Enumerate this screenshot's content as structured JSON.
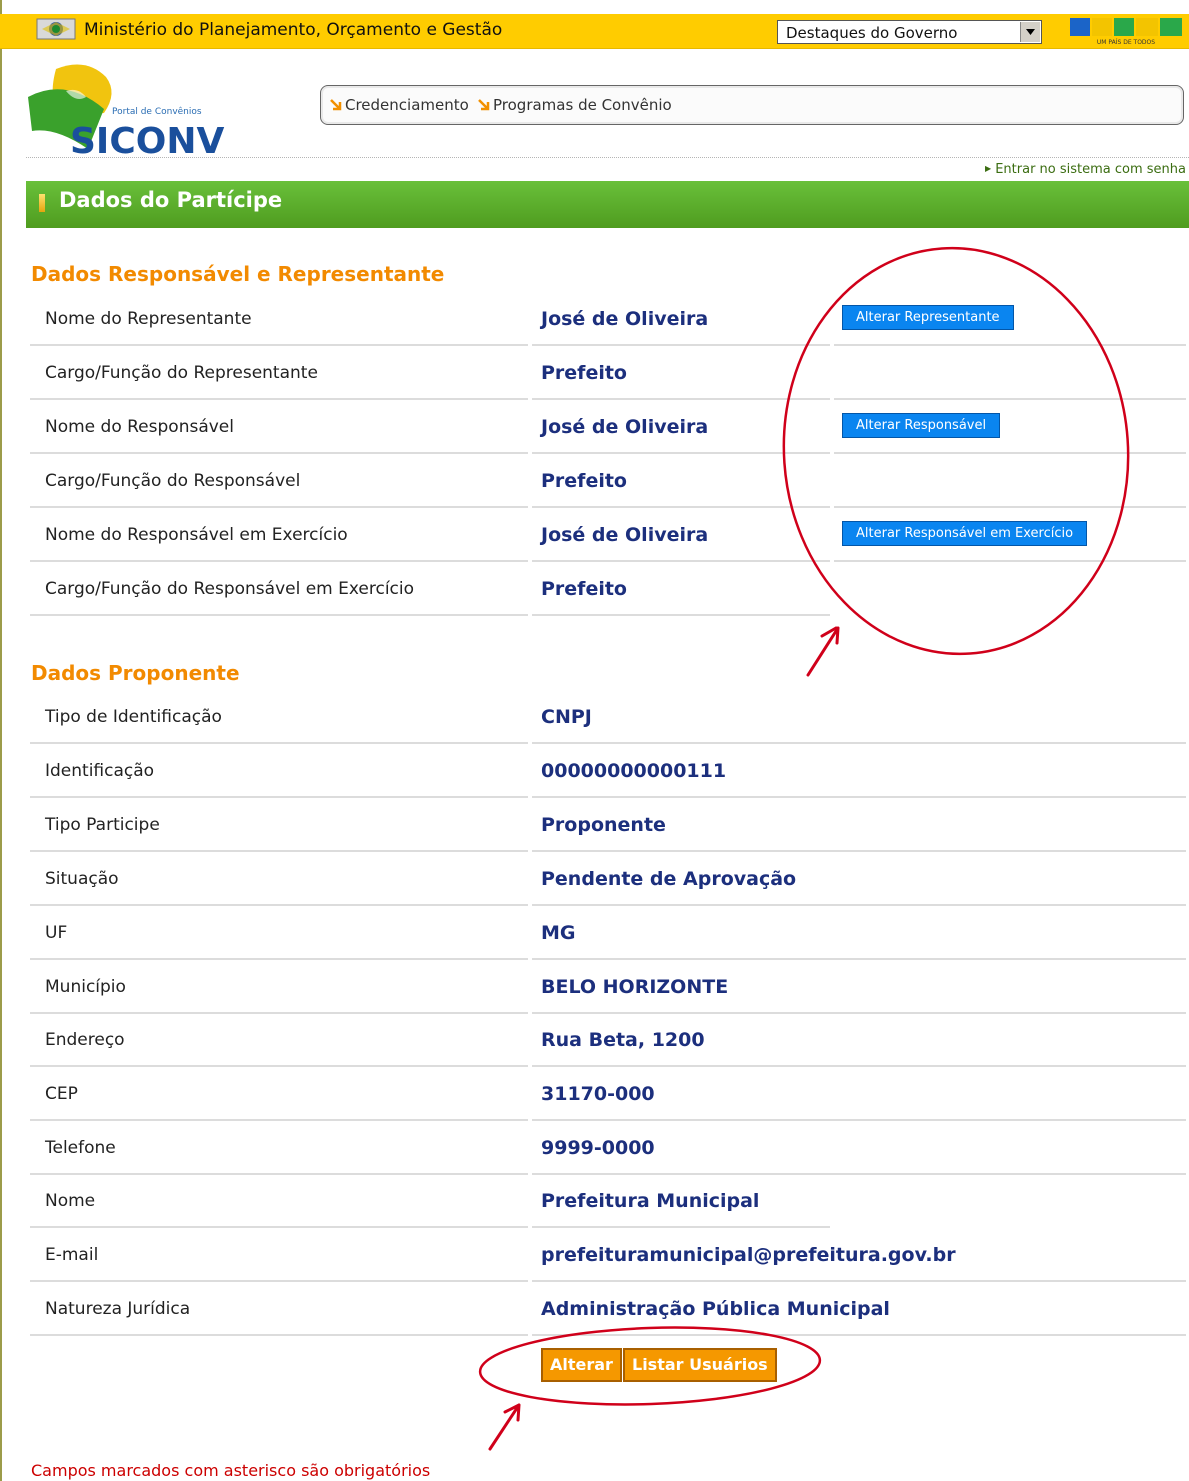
{
  "gov_bar": {
    "title": "Ministério do Planejamento, Orçamento e Gestão",
    "select_value": "Destaques do Governo",
    "brasil_logo": "BRASIL",
    "brasil_tagline": "UM PAÍS DE TODOS"
  },
  "header": {
    "logo_subtitle": "Portal de Convênios",
    "logo_name": "SICONV",
    "nav": [
      {
        "label": "Credenciamento",
        "icon": "orange-arrow-icon"
      },
      {
        "label": "Programas de Convênio",
        "icon": "orange-arrow-icon"
      }
    ],
    "login_link": "Entrar no sistema com senha"
  },
  "page_title": "Dados do Partícipe",
  "responsavel_section": {
    "title": "Dados Responsável e Representante",
    "rows": [
      {
        "label": "Nome do Representante",
        "value": "José de Oliveira",
        "button": "Alterar Representante"
      },
      {
        "label": "Cargo/Função do Representante",
        "value": "Prefeito"
      },
      {
        "label": "Nome do Responsável",
        "value": "José de Oliveira",
        "button": "Alterar Responsável"
      },
      {
        "label": "Cargo/Função do Responsável",
        "value": "Prefeito"
      },
      {
        "label": "Nome do Responsável em Exercício",
        "value": "José de Oliveira",
        "button": "Alterar Responsável em Exercício"
      },
      {
        "label": "Cargo/Função do Responsável em Exercício",
        "value": "Prefeito"
      }
    ]
  },
  "proponente_section": {
    "title": "Dados Proponente",
    "rows": [
      {
        "label": "Tipo de Identificação",
        "value": "CNPJ"
      },
      {
        "label": "Identificação",
        "value": "00000000000111"
      },
      {
        "label": "Tipo Participe",
        "value": "Proponente"
      },
      {
        "label": "Situação",
        "value": "Pendente de Aprovação"
      },
      {
        "label": "UF",
        "value": "MG"
      },
      {
        "label": "Município",
        "value": "BELO HORIZONTE"
      },
      {
        "label": "Endereço",
        "value": "Rua Beta, 1200"
      },
      {
        "label": "CEP",
        "value": "31170-000"
      },
      {
        "label": "Telefone",
        "value": "9999-0000"
      },
      {
        "label": "Nome",
        "value": "Prefeitura Municipal"
      },
      {
        "label": "E-mail",
        "value": "prefeituramunicipal@prefeitura.gov.br"
      },
      {
        "label": "Natureza Jurídica",
        "value": "Administração Pública Municipal"
      }
    ]
  },
  "actions": {
    "alterar": "Alterar",
    "listar_usuarios": "Listar Usuários"
  },
  "required_note": "Campos marcados com asterisco são obrigatórios",
  "colors": {
    "gov_bar": "#ffcc00",
    "title_bar": "#5aab2a",
    "section_title": "#f28a00",
    "value_text": "#1c2f7d",
    "blue_button": "#0a85f0",
    "orange_button": "#f59800",
    "annotation": "#d0001a"
  }
}
